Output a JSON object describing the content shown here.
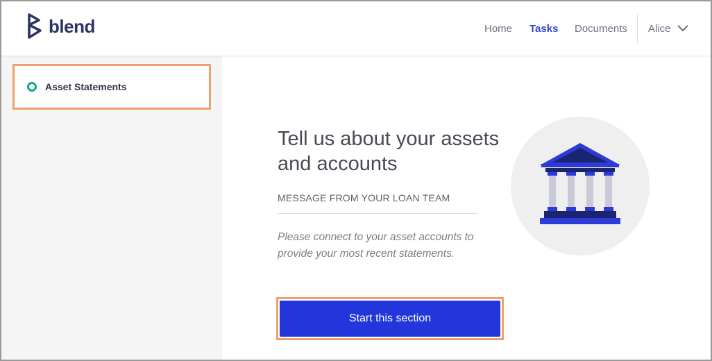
{
  "brand": {
    "name": "blend"
  },
  "nav": {
    "items": [
      {
        "label": "Home",
        "active": false
      },
      {
        "label": "Tasks",
        "active": true
      },
      {
        "label": "Documents",
        "active": false
      }
    ],
    "user": {
      "name": "Alice",
      "icon": "chevron-down-icon"
    }
  },
  "sidebar": {
    "items": [
      {
        "label": "Asset Statements",
        "status_icon": "status-ring-icon",
        "status_color": "#17a589"
      }
    ]
  },
  "main": {
    "title": "Tell us about your assets and accounts",
    "subheading": "MESSAGE FROM YOUR LOAN TEAM",
    "message": "Please connect to your asset accounts to provide your most recent statements.",
    "cta_label": "Start this section",
    "illustration_icon": "bank-building-icon"
  },
  "colors": {
    "accent": "#2236db",
    "active_nav": "#2f49d1",
    "brand": "#2c3464",
    "highlight_outline": "#f0a06a",
    "status_green": "#17a589"
  }
}
